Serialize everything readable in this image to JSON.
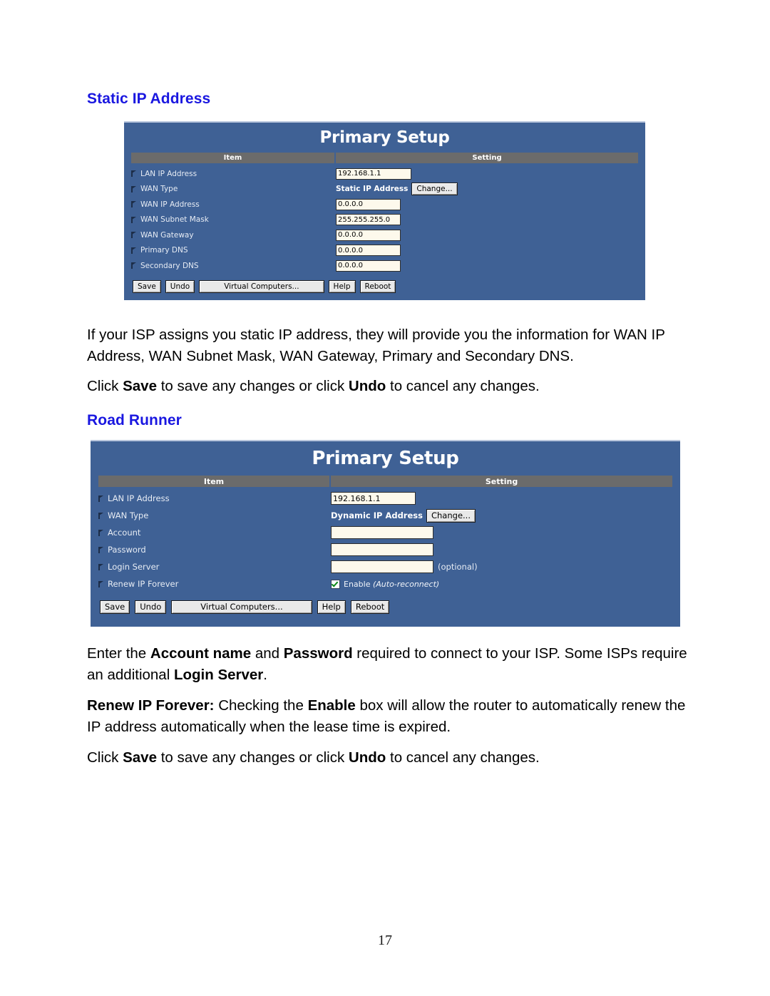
{
  "document": {
    "page_number": "17",
    "heading_color": "#1a17e0"
  },
  "sections": {
    "static_ip": {
      "heading": "Static IP Address",
      "paragraph_1": "If your ISP assigns you static IP address, they will provide you the information for WAN IP Address, WAN Subnet Mask, WAN Gateway, Primary and Secondary DNS.",
      "paragraph_2_parts": {
        "a": "Click ",
        "save": "Save",
        "b": " to save any changes or click ",
        "undo": "Undo",
        "c": " to cancel any changes."
      }
    },
    "road_runner": {
      "heading": "Road Runner",
      "paragraph_1_parts": {
        "a": "Enter the ",
        "account": "Account name",
        "b": " and ",
        "password": "Password",
        "c": " required to connect to your ISP. Some ISPs require an additional ",
        "login_server": "Login Server",
        "d": "."
      },
      "paragraph_2_parts": {
        "renew": "Renew IP Forever:",
        "a": " Checking the ",
        "enable": "Enable",
        "b": " box will allow the router to automatically renew the IP address automatically when the lease time is expired."
      },
      "paragraph_3_parts": {
        "a": "Click ",
        "save": "Save",
        "b": " to save any changes or click ",
        "undo": "Undo",
        "c": " to cancel any changes."
      }
    }
  },
  "panel_static": {
    "title": "Primary Setup",
    "colors": {
      "panel_bg": "#3f6195",
      "header_bg": "#6b6b6b",
      "field_bg": "#fdf9ec"
    },
    "columns": {
      "item": "Item",
      "setting": "Setting"
    },
    "rows": [
      {
        "label": "LAN IP Address",
        "value": "192.168.1.1",
        "kind": "field"
      },
      {
        "label": "WAN Type",
        "value": "Static IP Address",
        "button": "Change...",
        "kind": "wantype"
      },
      {
        "label": "WAN IP Address",
        "value": "0.0.0.0",
        "kind": "field"
      },
      {
        "label": "WAN Subnet Mask",
        "value": "255.255.255.0",
        "kind": "field"
      },
      {
        "label": "WAN Gateway",
        "value": "0.0.0.0",
        "kind": "field"
      },
      {
        "label": "Primary DNS",
        "value": "0.0.0.0",
        "kind": "field"
      },
      {
        "label": "Secondary DNS",
        "value": "0.0.0.0",
        "kind": "field"
      }
    ],
    "buttons": {
      "save": "Save",
      "undo": "Undo",
      "virtual_computers": "Virtual Computers...",
      "help": "Help",
      "reboot": "Reboot"
    }
  },
  "panel_road_runner": {
    "title": "Primary Setup",
    "columns": {
      "item": "Item",
      "setting": "Setting"
    },
    "rows": [
      {
        "label": "LAN IP Address",
        "value": "192.168.1.1",
        "kind": "field"
      },
      {
        "label": "WAN Type",
        "value": "Dynamic IP Address",
        "button": "Change...",
        "kind": "wantype"
      },
      {
        "label": "Account",
        "value": "",
        "kind": "field"
      },
      {
        "label": "Password",
        "value": "",
        "kind": "field"
      },
      {
        "label": "Login Server",
        "value": "",
        "note": "(optional)",
        "kind": "field"
      },
      {
        "label": "Renew IP Forever",
        "checkbox_label": "Enable",
        "checkbox_note": "(Auto-reconnect)",
        "checked": true,
        "kind": "checkbox"
      }
    ],
    "buttons": {
      "save": "Save",
      "undo": "Undo",
      "virtual_computers": "Virtual Computers...",
      "help": "Help",
      "reboot": "Reboot"
    }
  }
}
